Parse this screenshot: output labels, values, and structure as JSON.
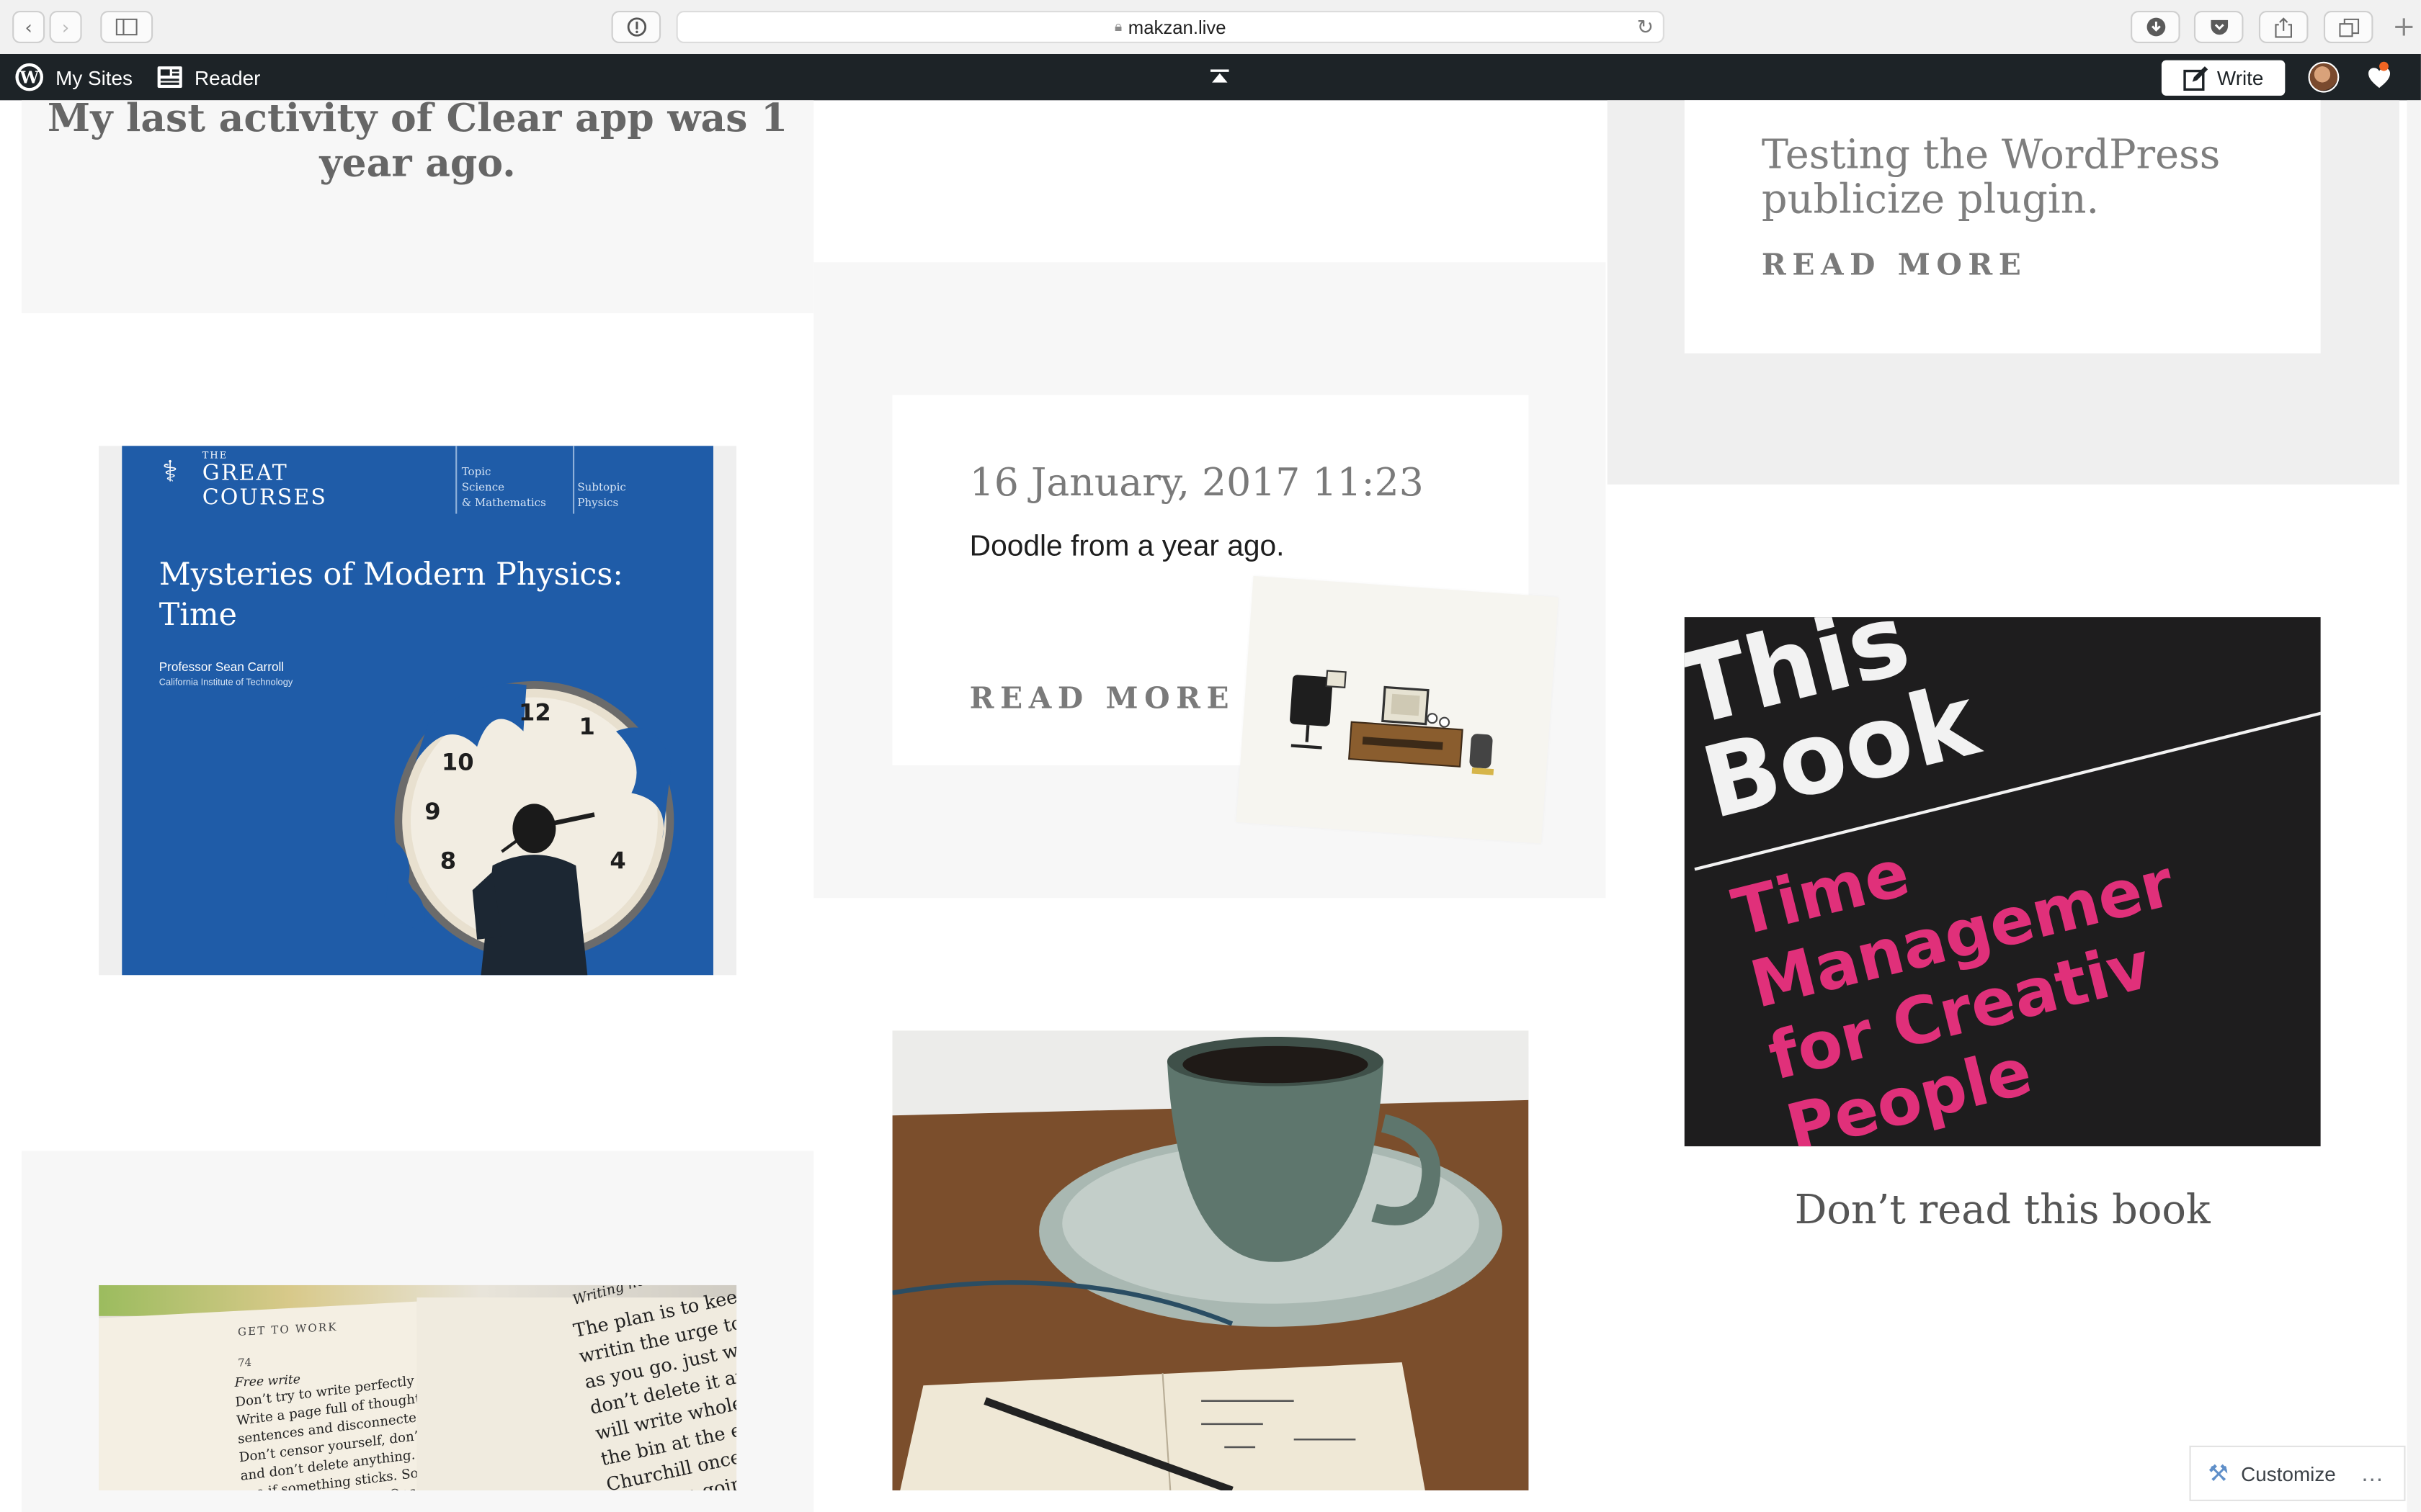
{
  "browser": {
    "url": "makzan.live"
  },
  "admin_bar": {
    "my_sites": "My Sites",
    "reader": "Reader",
    "write": "Write"
  },
  "posts": {
    "clear_app": {
      "title_partial": "My last activity of Clear app was 1",
      "title_line2": "year ago."
    },
    "wp_publicize": {
      "title": "Testing the WordPress publicize plugin.",
      "read_more": "READ MORE"
    },
    "doodle": {
      "date": "16 January, 2017 11:23",
      "excerpt": "Doodle from a year ago.",
      "read_more": "READ MORE"
    },
    "great_courses": {
      "brand_small": "THE",
      "brand_line1": "GREAT",
      "brand_line2": "COURSES",
      "topic_label": "Topic",
      "topic_line1": "Science",
      "topic_line2": "& Mathematics",
      "subtopic_label": "Subtopic",
      "subtopic_value": "Physics",
      "title_line1": "Mysteries of Modern Physics:",
      "title_line2": "Time",
      "professor": "Professor Sean Carroll",
      "institution": "California Institute of Technology",
      "clock_numbers": [
        "12",
        "1",
        "10",
        "9",
        "8",
        "4"
      ]
    },
    "book": {
      "cover_line1": "This",
      "cover_line2": "Book",
      "cover_line3": "Time",
      "cover_line4": "Managemer",
      "cover_line5": "for Creativ",
      "cover_line6": "People",
      "caption": "Don’t read this book"
    },
    "open_book": {
      "page_number": "74",
      "header": "GET TO WORK",
      "subhead": "Free write",
      "left_text": "Don’t try to write perfectly from the start. Write a page full of thoughts, ideas, bad sentences and disconnected ramblings. Don’t censor yourself, don’t fix grammar, and don’t delete anything. Fill a page and see if something sticks. Some writing is a page with no writing. Once you’ve got something",
      "right_head": "Writing hot",
      "right_text": "The plan is to keep writin the urge to edit as you go. just wrote, don’t delete it authors will write whole them in the bin at the en Churchill once said, ‘Wh fall, keep going.’ He was for the sake of this tas"
    }
  },
  "customize": {
    "label": "Customize"
  },
  "colors": {
    "wp_bar": "#1d2327",
    "tile_gray": "#f7f7f7",
    "tile_darker": "#efefef",
    "book_pink": "#e0307a",
    "cover_blue": "#1f5ca8",
    "notification": "#f26522"
  },
  "icons": [
    "back-icon",
    "forward-icon",
    "sidebar-icon",
    "privacy-icon",
    "lock-icon",
    "reload-icon",
    "download-icon",
    "pocket-icon",
    "share-icon",
    "tabs-icon",
    "new-tab-icon",
    "wordpress-icon",
    "reader-icon",
    "scroll-top-icon",
    "write-icon",
    "notifications-icon",
    "customize-icon",
    "more-icon"
  ]
}
